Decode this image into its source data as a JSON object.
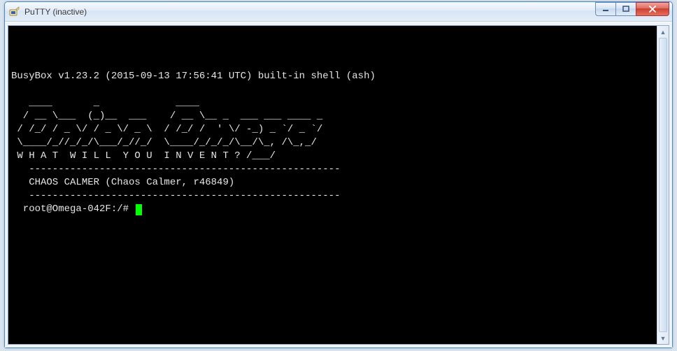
{
  "window": {
    "title": "PuTTY (inactive)",
    "icon_name": "putty-icon"
  },
  "terminal": {
    "lines": [
      "",
      "",
      "",
      "BusyBox v1.23.2 (2015-09-13 17:56:41 UTC) built-in shell (ash)",
      "",
      "   ____       _             ____",
      "  / __ \\___  (_)__  ___    / __ \\__ _  ___ ___ ____ _",
      " / /_/ / _ \\/ / _ \\/ _ \\  / /_/ /  ' \\/ -_) _ `/ _ `/",
      " \\____/_//_/_/\\___/_//_/  \\____/_/_/_/\\__/\\_, /\\_,_/",
      " W H A T  W I L L  Y O U  I N V E N T ? /___/",
      "   -----------------------------------------------------",
      "   CHAOS CALMER (Chaos Calmer, r46849)",
      "   -----------------------------------------------------"
    ],
    "prompt": "  root@Omega-042F:/# "
  }
}
